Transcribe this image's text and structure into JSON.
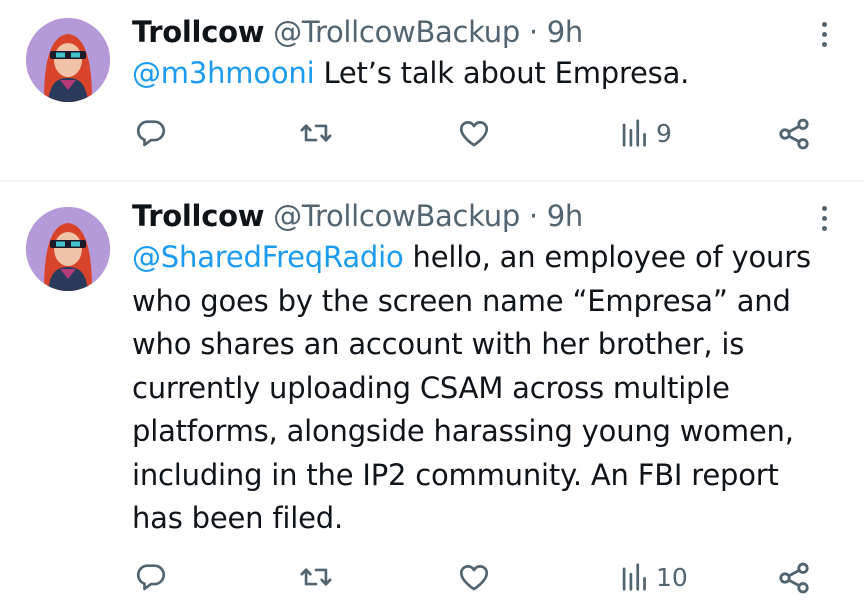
{
  "tweets": [
    {
      "name": "Trollcow",
      "handle": "@TrollcowBackup",
      "separator": "·",
      "time": "9h",
      "mention": "@m3hmooni",
      "text": " Let’s talk about Empresa.",
      "views": "9"
    },
    {
      "name": "Trollcow",
      "handle": "@TrollcowBackup",
      "separator": "·",
      "time": "9h",
      "mention": "@SharedFreqRadio",
      "text": " hello, an employee of yours who goes by the screen name “Empresa” and who shares an account with her brother, is currently uploading CSAM across multiple platforms, alongside harassing young women, including in the IP2 community. An FBI report has been filed.",
      "views": "10"
    }
  ],
  "icons": {
    "reply": "reply-icon",
    "retweet": "retweet-icon",
    "like": "heart-icon",
    "views": "views-icon",
    "share": "share-icon",
    "more": "more-options-icon"
  },
  "colors": {
    "text": "#0f1419",
    "secondary": "#536471",
    "link": "#1d9bf0",
    "divider": "#eff3f4"
  }
}
